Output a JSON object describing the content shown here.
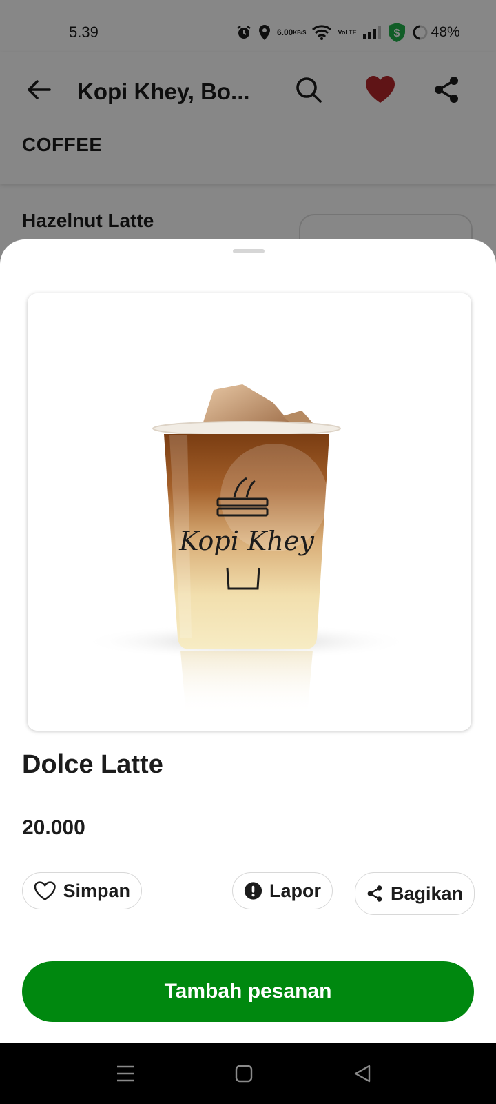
{
  "status_bar": {
    "time": "5.39",
    "net_speed": "6.00",
    "net_speed_unit": "KB/S",
    "volte_top": "Vo",
    "volte_bottom": "LTE",
    "battery": "48%",
    "icons": [
      "alarm-icon",
      "location-icon",
      "wifi-icon",
      "signal-icon",
      "shield-dollar-icon",
      "battery-ring-icon"
    ]
  },
  "app_bar": {
    "title": "Kopi Khey, Bo...",
    "icons": [
      "back-arrow-icon",
      "search-icon",
      "heart-icon",
      "share-icon"
    ],
    "favorite_color": "#b3262a"
  },
  "menu": {
    "category": "COFFEE",
    "items": [
      {
        "name": "Hazelnut Latte"
      }
    ]
  },
  "product": {
    "name": "Dolce Latte",
    "price": "20.000",
    "image_logo_text": "Kopi Khey"
  },
  "actions": {
    "save_label": "Simpan",
    "report_label": "Lapor",
    "share_label": "Bagikan"
  },
  "primary_button": {
    "label": "Tambah pesanan",
    "color": "#00880f"
  },
  "nav_bar": {
    "icons": [
      "recents-menu-icon",
      "home-square-icon",
      "back-triangle-icon"
    ]
  }
}
